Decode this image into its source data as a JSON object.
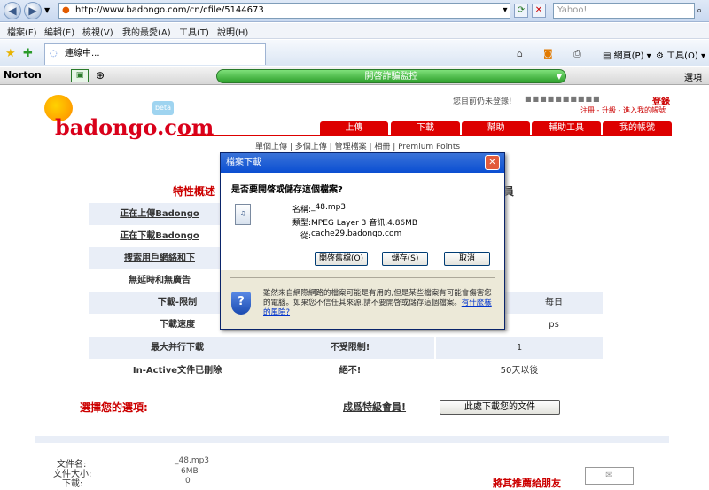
{
  "browser": {
    "url": "http://www.badongo.com/cn/cfile/5144673",
    "search_placeholder": "Yahoo!",
    "menu": [
      "檔案(F)",
      "編輯(E)",
      "檢視(V)",
      "我的最愛(A)",
      "工具(T)",
      "說明(H)"
    ],
    "tab_title": "連線中...",
    "toolbar": {
      "page_label": "網頁(P)",
      "tools_label": "工具(O)"
    }
  },
  "norton": {
    "logo": "Norton",
    "bar_label": "開啓詐騙監控",
    "options": "選項"
  },
  "site": {
    "logo": "badongo.com",
    "beta": "beta",
    "login_text": "您目前仍未登錄!",
    "login_link": "登錄",
    "register_links": "注冊 - 升級 - 進入我的帳號",
    "tabs": [
      "上傳",
      "下載",
      "幫助",
      "輔助工具",
      "我的帳號"
    ],
    "subnav": [
      "單個上傳",
      "多個上傳",
      "管理檔案",
      "相冊",
      "Premium Points"
    ],
    "features_heading": "特性概述",
    "premium_heading": "員",
    "rows": [
      {
        "label": "正在上傳Badongo",
        "free": "",
        "premium": ""
      },
      {
        "label": "正在下載Badongo",
        "free": "",
        "premium": ""
      },
      {
        "label": "搜索用戶網絡和下",
        "free": "",
        "premium": ""
      },
      {
        "label": "無延時和無廣告",
        "free": "",
        "premium": ""
      },
      {
        "label": "下載-限制",
        "free": "",
        "premium": "每日"
      },
      {
        "label": "下載速度",
        "free": "",
        "premium": "ps"
      },
      {
        "label": "最大并行下載",
        "free": "不受限制!",
        "premium": "1"
      },
      {
        "label": "In-Active文件已刪除",
        "free": "絕不!",
        "premium": "50天以後"
      }
    ],
    "choose_option": "選擇您的選項:",
    "become_premium": "成爲特級會員!",
    "download_button": "此處下載您的文件",
    "file_info": {
      "name_label": "文件名:",
      "name_value": "_48.mp3",
      "size_label": "文件大小:",
      "size_value": "6MB",
      "downloads_label": "下載:",
      "downloads_value": "0"
    },
    "recommend": "將其推薦給朋友"
  },
  "dialog": {
    "title": "檔案下載",
    "question": "是否要開啓或儲存這個檔案?",
    "name_label": "名稱:",
    "name_value": "_48.mp3",
    "type_label": "類型:",
    "type_value": "MPEG Layer 3 音訊,4.86MB",
    "from_label": "從:",
    "from_value": "cache29.badongo.com",
    "open_button": "開啓舊檔(O)",
    "save_button": "儲存(S)",
    "cancel_button": "取消",
    "warning": "雖然來自網際網路的檔案可能是有用的,但是某些檔案有可能會傷害您的電腦。如果您不信任其來源,請不要開啓或儲存這個檔案。",
    "risk_link": "有什麼樣的風險?"
  }
}
